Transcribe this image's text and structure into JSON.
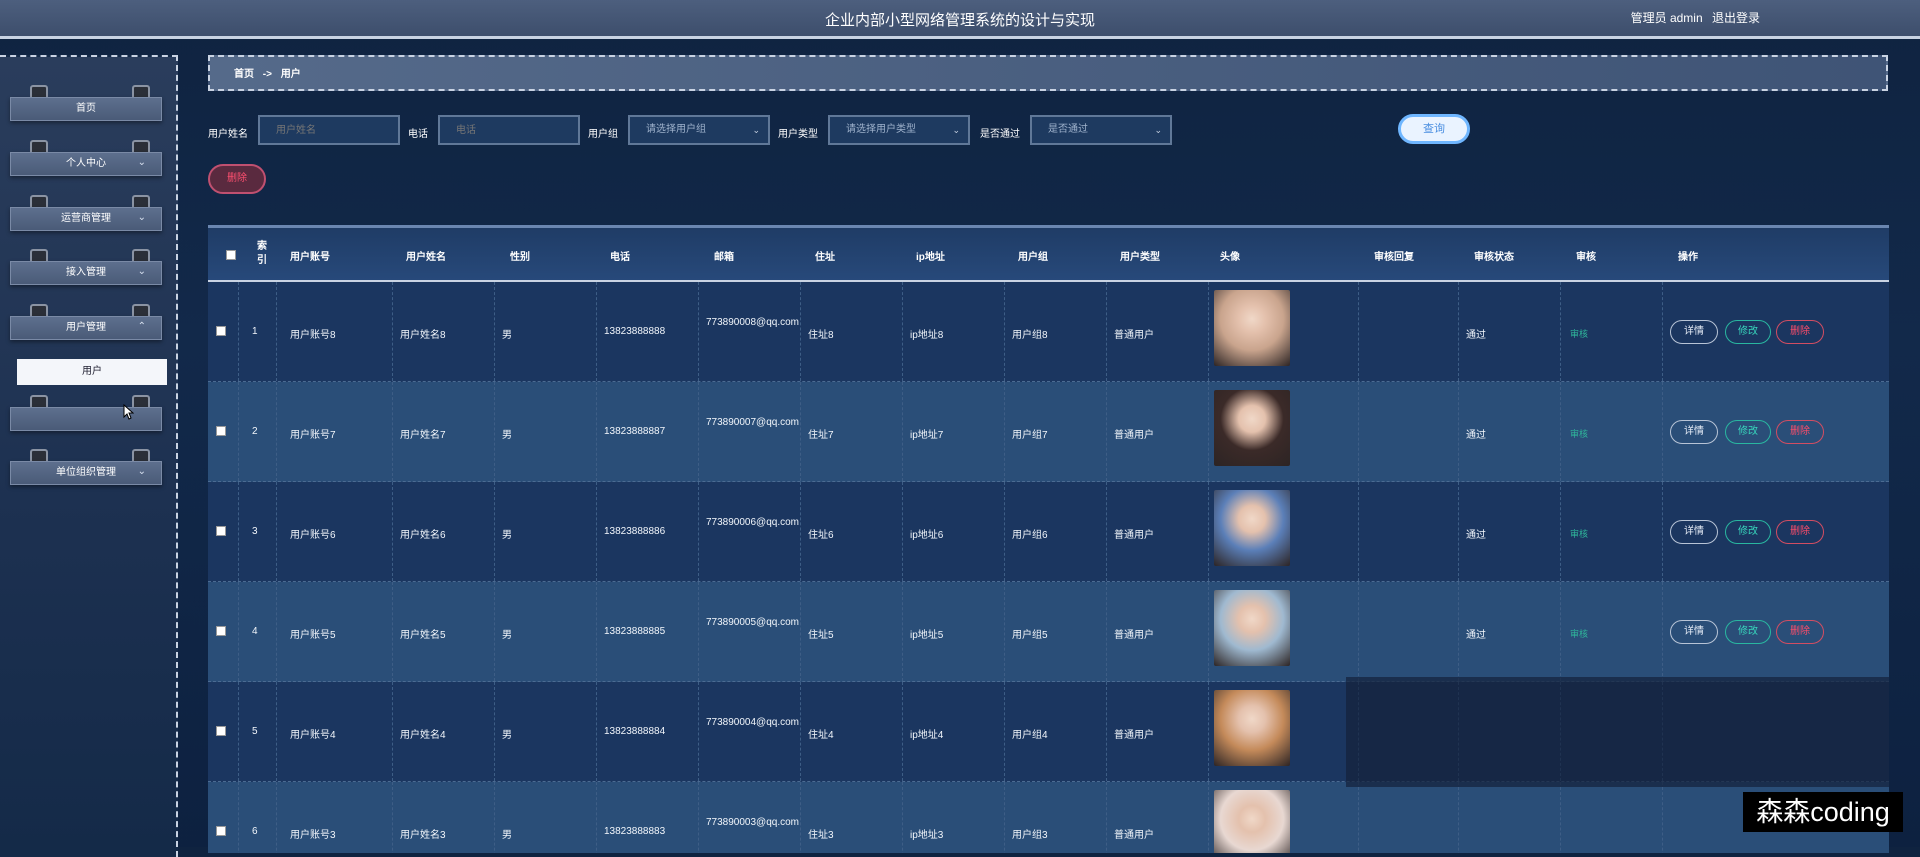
{
  "app_title": "企业内部小型网络管理系统的设计与实现",
  "header": {
    "admin_label": "管理员 admin",
    "logout_label": "退出登录"
  },
  "sidebar": {
    "items": [
      {
        "label": "首页",
        "has_chevron": false
      },
      {
        "label": "个人中心",
        "has_chevron": true
      },
      {
        "label": "运营商管理",
        "has_chevron": true
      },
      {
        "label": "接入管理",
        "has_chevron": true
      },
      {
        "label": "用户管理",
        "has_chevron": true,
        "expanded": true
      },
      {
        "label": "",
        "has_chevron": false
      },
      {
        "label": "单位组织管理",
        "has_chevron": true
      }
    ],
    "submenu_active": "用户"
  },
  "breadcrumb": {
    "home": "首页",
    "sep": "->",
    "current": "用户"
  },
  "search": {
    "name_label": "用户姓名",
    "name_placeholder": "用户姓名",
    "phone_label": "电话",
    "phone_placeholder": "电话",
    "group_label": "用户组",
    "group_value": "请选择用户组",
    "type_label": "用户类型",
    "type_value": "请选择用户类型",
    "pass_label": "是否通过",
    "pass_value": "是否通过",
    "query_button": "查询"
  },
  "delete_button": "删除",
  "table": {
    "headers": [
      "索引",
      "用户账号",
      "用户姓名",
      "性别",
      "电话",
      "邮箱",
      "住址",
      "ip地址",
      "用户组",
      "用户类型",
      "头像",
      "审核回复",
      "审核状态",
      "审核",
      "操作"
    ],
    "rows": [
      {
        "idx": "1",
        "account": "用户账号8",
        "name": "用户姓名8",
        "sex": "男",
        "phone": "13823888888",
        "email": "773890008@qq.com",
        "addr": "住址8",
        "ip": "ip地址8",
        "group": "用户组8",
        "type": "普通用户",
        "reply": "",
        "status": "通过",
        "audit": "审核",
        "avatar_color": "#c9a48d"
      },
      {
        "idx": "2",
        "account": "用户账号7",
        "name": "用户姓名7",
        "sex": "男",
        "phone": "13823888887",
        "email": "773890007@qq.com",
        "addr": "住址7",
        "ip": "ip地址7",
        "group": "用户组7",
        "type": "普通用户",
        "reply": "",
        "status": "通过",
        "audit": "审核",
        "avatar_color": "#3b2a28"
      },
      {
        "idx": "3",
        "account": "用户账号6",
        "name": "用户姓名6",
        "sex": "男",
        "phone": "13823888886",
        "email": "773890006@qq.com",
        "addr": "住址6",
        "ip": "ip地址6",
        "group": "用户组6",
        "type": "普通用户",
        "reply": "",
        "status": "通过",
        "audit": "审核",
        "avatar_color": "#5b7fb8"
      },
      {
        "idx": "4",
        "account": "用户账号5",
        "name": "用户姓名5",
        "sex": "男",
        "phone": "13823888885",
        "email": "773890005@qq.com",
        "addr": "住址5",
        "ip": "ip地址5",
        "group": "用户组5",
        "type": "普通用户",
        "reply": "",
        "status": "通过",
        "audit": "审核",
        "avatar_color": "#9fb9d0"
      },
      {
        "idx": "5",
        "account": "用户账号4",
        "name": "用户姓名4",
        "sex": "男",
        "phone": "13823888884",
        "email": "773890004@qq.com",
        "addr": "住址4",
        "ip": "ip地址4",
        "group": "用户组4",
        "type": "普通用户",
        "reply": "",
        "status": "",
        "audit": "",
        "avatar_color": "#c48a5a"
      },
      {
        "idx": "6",
        "account": "用户账号3",
        "name": "用户姓名3",
        "sex": "男",
        "phone": "13823888883",
        "email": "773890003@qq.com",
        "addr": "住址3",
        "ip": "ip地址3",
        "group": "用户组3",
        "type": "普通用户",
        "reply": "",
        "status": "",
        "audit": "",
        "avatar_color": "#e8d8d2"
      }
    ],
    "row_buttons": {
      "detail": "详情",
      "edit": "修改",
      "delete": "删除"
    }
  },
  "watermark": "森森coding"
}
